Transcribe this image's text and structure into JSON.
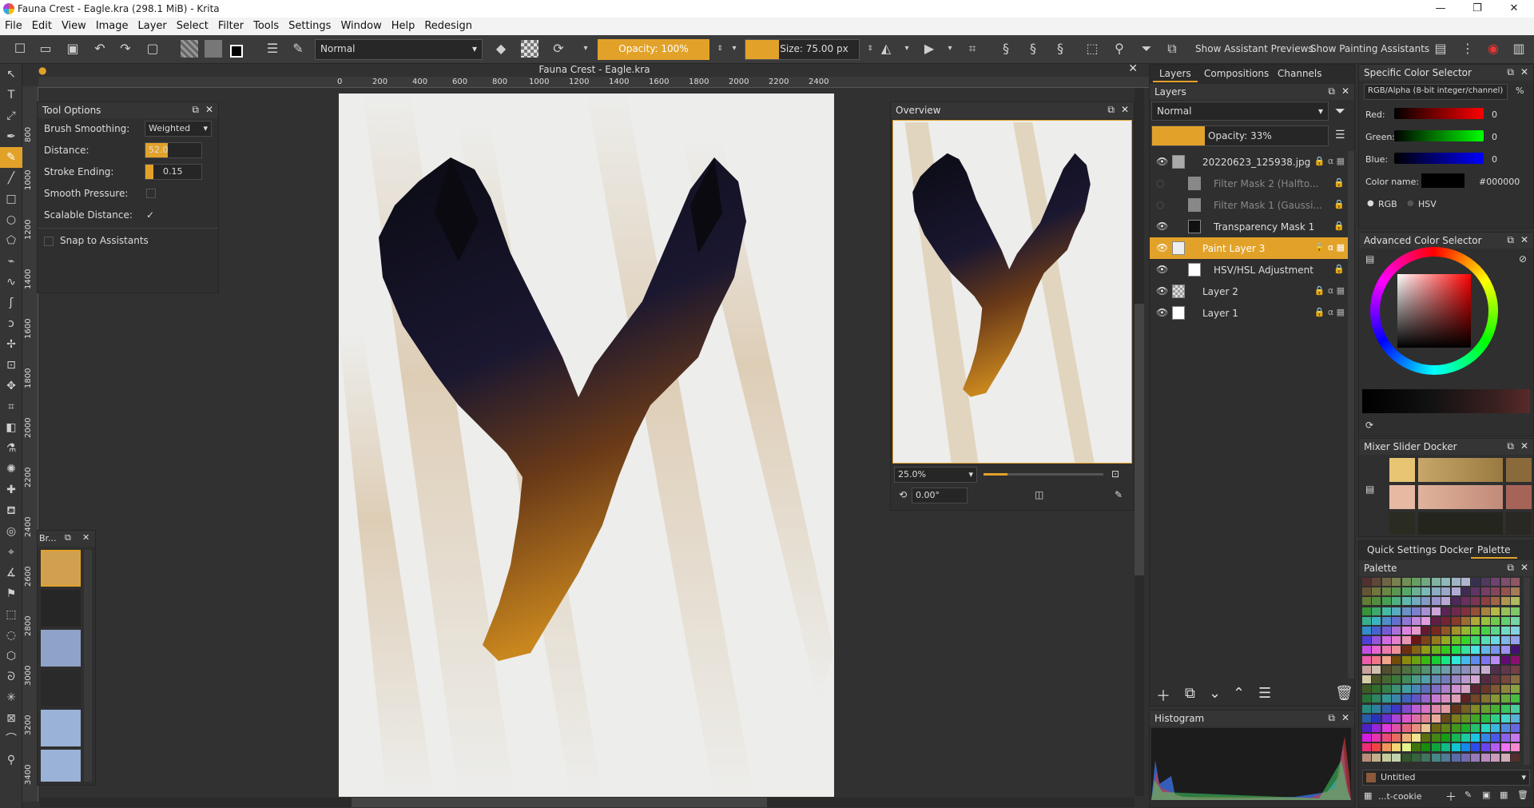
{
  "window": {
    "title": "Fauna Crest - Eagle.kra (298.1 MiB) - Krita"
  },
  "menu": [
    "File",
    "Edit",
    "View",
    "Image",
    "Layer",
    "Select",
    "Filter",
    "Tools",
    "Settings",
    "Window",
    "Help",
    "Redesign"
  ],
  "toolbar": {
    "blend_mode": "Normal",
    "opacity": "Opacity: 100%",
    "size": "Size: 75.00 px",
    "show_assistant_previews": "Show Assistant Previews",
    "show_painting_assistants": "Show Painting Assistants"
  },
  "canvas": {
    "document_title": "Fauna Crest - Eagle.kra",
    "hruler_ticks": [
      "0",
      "200",
      "400",
      "600",
      "800",
      "1000",
      "1200",
      "1400",
      "1600",
      "1800",
      "2000",
      "2200",
      "2400"
    ],
    "vruler_ticks": [
      "800",
      "1000",
      "1200",
      "1400",
      "1600",
      "1800",
      "2000",
      "2200",
      "2400",
      "2600",
      "2800",
      "3000",
      "3200",
      "3400"
    ]
  },
  "tool_options": {
    "title": "Tool Options",
    "brush_smoothing_label": "Brush Smoothing:",
    "brush_smoothing_value": "Weighted",
    "distance_label": "Distance:",
    "distance_value": "52.0",
    "stroke_ending_label": "Stroke Ending:",
    "stroke_ending_value": "0.15",
    "smooth_pressure_label": "Smooth Pressure:",
    "scalable_distance_label": "Scalable Distance:",
    "scalable_distance_check": "✓",
    "snap_label": "Snap to Assistants"
  },
  "brushes_docker": {
    "title": "Br..."
  },
  "overview": {
    "title": "Overview",
    "zoom": "25.0%",
    "rotation": "0.00°"
  },
  "layers_panel": {
    "tabs": [
      "Layers",
      "Compositions",
      "Channels"
    ],
    "title": "Layers",
    "blend_mode": "Normal",
    "opacity": "Opacity:  33%",
    "layers": [
      {
        "name": "20220623_125938.jpg",
        "visible": true
      },
      {
        "name": "Filter Mask 2 (Halfto...",
        "visible": false
      },
      {
        "name": "Filter Mask 1 (Gaussi...",
        "visible": false
      },
      {
        "name": "Transparency Mask 1",
        "visible": true
      },
      {
        "name": "Paint Layer 3",
        "visible": true
      },
      {
        "name": "HSV/HSL Adjustment",
        "visible": true
      },
      {
        "name": "Layer 2",
        "visible": true
      },
      {
        "name": "Layer 1",
        "visible": true
      }
    ]
  },
  "histogram": {
    "title": "Histogram"
  },
  "color_selector": {
    "title": "Specific Color Selector",
    "model": "RGB/Alpha (8-bit integer/channel)",
    "percent": "%",
    "red_label": "Red:",
    "red_value": "0",
    "green_label": "Green:",
    "green_value": "0",
    "blue_label": "Blue:",
    "blue_value": "0",
    "color_name_label": "Color name:",
    "color_name_value": "#000000",
    "rgb_label": "RGB",
    "hsv_label": "HSV"
  },
  "advanced_color_selector": {
    "title": "Advanced Color Selector"
  },
  "mixer": {
    "title": "Mixer Slider Docker"
  },
  "quick_settings": {
    "tabs": [
      "Quick Settings Docker",
      "Palette"
    ]
  },
  "palette": {
    "title": "Palette",
    "name": "Untitled",
    "footer": "...t-cookie"
  },
  "colors": {
    "accent": "#e2a22a",
    "panel": "#2f2f2f",
    "canvas_bg": "#313131",
    "paper": "#ededeb"
  }
}
